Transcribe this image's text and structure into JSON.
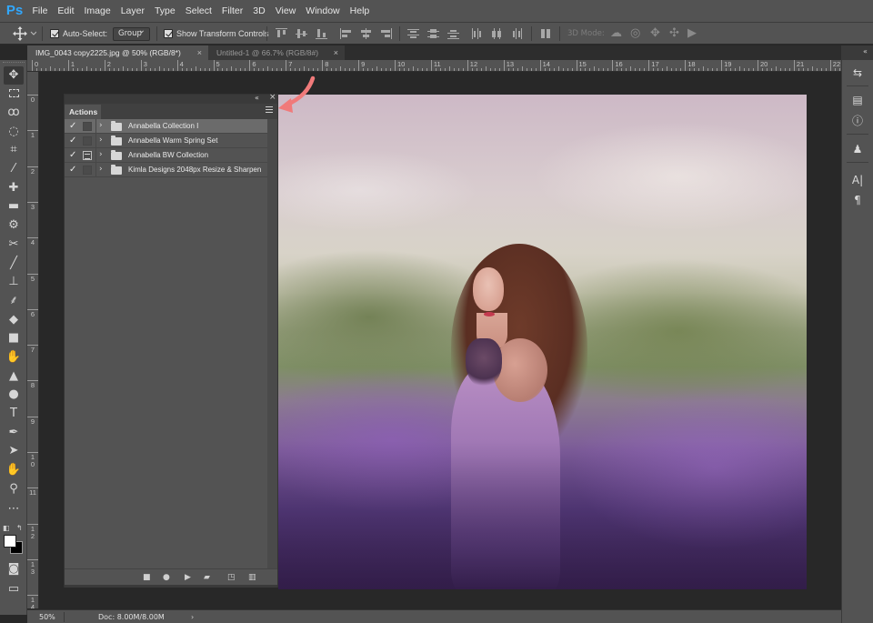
{
  "app": {
    "logo": "Ps"
  },
  "menu": [
    "File",
    "Edit",
    "Image",
    "Layer",
    "Type",
    "Select",
    "Filter",
    "3D",
    "View",
    "Window",
    "Help"
  ],
  "options_bar": {
    "auto_select_label": "Auto-Select:",
    "auto_select_checked": true,
    "auto_select_value": "Group",
    "transform_label": "Show Transform Controls",
    "transform_checked": true,
    "mode_3d_label": "3D Mode:"
  },
  "tabs": [
    {
      "label": "IMG_0043 copy2225.jpg @ 50% (RGB/8*)",
      "close": "×",
      "active": true
    },
    {
      "label": "Untitled-1 @ 66.7% (RGB/8#)",
      "close": "×",
      "active": false
    }
  ],
  "ruler_top": [
    "0",
    "1",
    "2",
    "3",
    "4",
    "5",
    "6",
    "7",
    "8",
    "9",
    "10",
    "11",
    "12",
    "13",
    "14",
    "15",
    "16",
    "17",
    "18",
    "19",
    "20",
    "21",
    "22"
  ],
  "ruler_left": [
    "0",
    "1",
    "2",
    "3",
    "4",
    "5",
    "6",
    "7",
    "8",
    "9",
    "10",
    "11",
    "12",
    "13",
    "14"
  ],
  "actions_panel": {
    "tab_label": "Actions",
    "collapse_glyph": "«",
    "close_glyph": "×",
    "items": [
      {
        "check": "✓",
        "dialog": false,
        "expand": "›",
        "name": "Annabella Collection I",
        "selected": true
      },
      {
        "check": "✓",
        "dialog": false,
        "expand": "›",
        "name": "Annabella Warm Spring Set",
        "selected": false
      },
      {
        "check": "✓",
        "dialog": true,
        "expand": "›",
        "name": "Annabella BW Collection",
        "selected": false
      },
      {
        "check": "✓",
        "dialog": false,
        "expand": "›",
        "name": "Kimla Designs 2048px Resize & Sharpen",
        "selected": false
      }
    ],
    "footer_icons": [
      "stop-icon",
      "record-icon",
      "play-icon",
      "new-set-icon",
      "new-action-icon",
      "trash-icon"
    ]
  },
  "status_bar": {
    "zoom": "50%",
    "doc": "Doc: 8.00M/8.00M",
    "arrow": "›"
  },
  "colors": {
    "accent": "#31a8ff",
    "annotation_arrow": "#f07a7a",
    "panel_bg": "#535353",
    "canvas_bg": "#282828"
  }
}
